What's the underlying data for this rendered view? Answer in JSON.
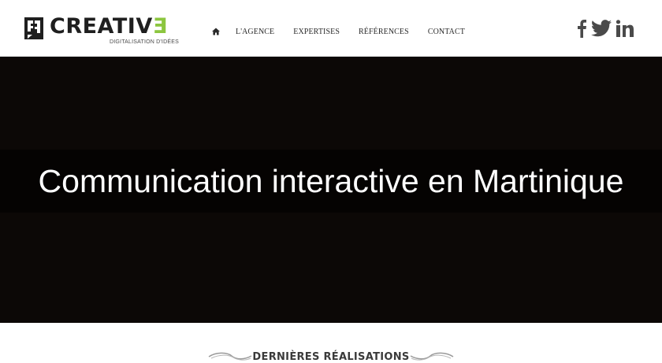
{
  "brand": {
    "name_main": "CREATIV",
    "name_accent": "Ǝ",
    "tagline": "DIGITALISATION D'IDÉES"
  },
  "nav": {
    "home_icon": "home-icon",
    "items": [
      {
        "label": "L'AGENCE"
      },
      {
        "label": "EXPERTISES"
      },
      {
        "label": "RÉFÉRENCES"
      },
      {
        "label": "CONTACT"
      }
    ]
  },
  "social": {
    "icons": [
      "facebook-icon",
      "twitter-icon",
      "linkedin-icon"
    ],
    "color": "#4a4a4a"
  },
  "hero": {
    "title": "Communication interactive en Martinique",
    "background": "#0c0806"
  },
  "section": {
    "title": "DERNIÈRES RÉALISATIONS"
  },
  "colors": {
    "accent": "#8cc63f",
    "text_dark": "#1f1f1f"
  }
}
